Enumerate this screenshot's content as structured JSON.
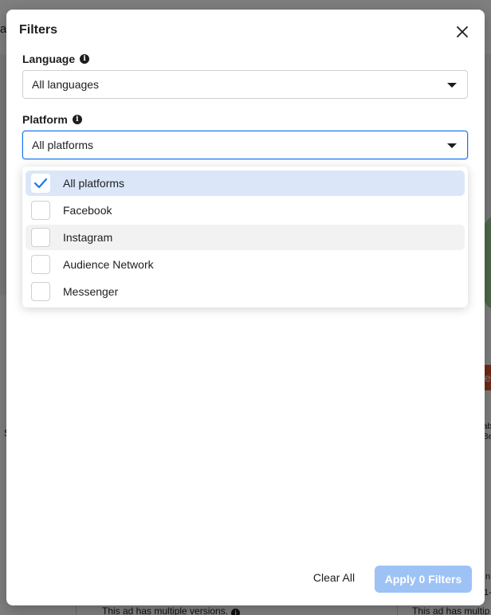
{
  "background": {
    "title_fragment": "a",
    "left_letter": "S",
    "right_fragment_top": "ab",
    "right_fragment_bottom": "Be",
    "right_orange_letter": "e",
    "versions_left": "This ad has multiple versions.",
    "versions_right": "This ad has multip",
    "side_fragment_1": "n",
    "side_fragment_2": "1-"
  },
  "modal": {
    "title": "Filters",
    "language": {
      "label": "Language",
      "selected": "All languages"
    },
    "platform": {
      "label": "Platform",
      "selected": "All platforms",
      "options": [
        {
          "label": "All platforms",
          "checked": true,
          "state": "selected"
        },
        {
          "label": "Facebook",
          "checked": false,
          "state": "normal"
        },
        {
          "label": "Instagram",
          "checked": false,
          "state": "hover"
        },
        {
          "label": "Audience Network",
          "checked": false,
          "state": "normal"
        },
        {
          "label": "Messenger",
          "checked": false,
          "state": "normal"
        }
      ]
    },
    "clear_label": "Clear All",
    "apply_label": "Apply 0 Filters"
  },
  "colors": {
    "accent": "#1877f2",
    "selected_bg": "#dbe7f8",
    "hover_bg": "#f2f2f2",
    "apply_disabled": "#9dc2f6"
  },
  "icons": {
    "close": "close-icon",
    "info": "info-icon",
    "caret": "chevron-down-icon",
    "check": "checkmark-icon"
  }
}
